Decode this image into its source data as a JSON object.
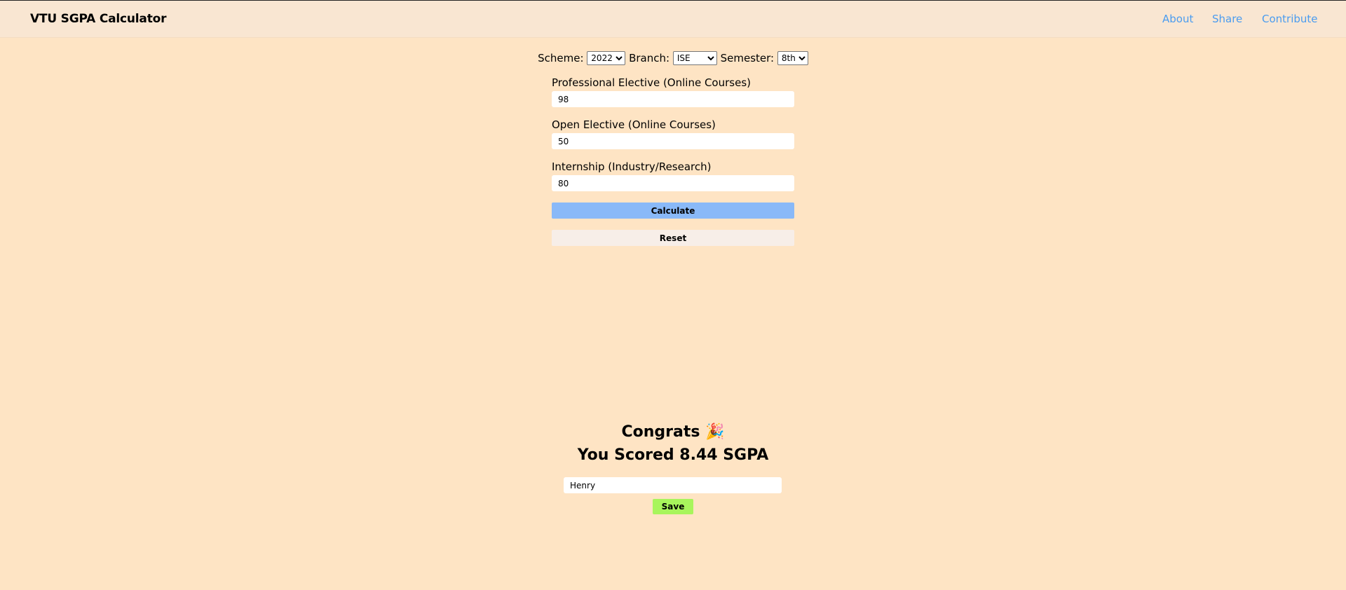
{
  "header": {
    "title": "VTU SGPA Calculator",
    "links": [
      "About",
      "Share",
      "Contribute"
    ]
  },
  "selectors": {
    "scheme_label": "Scheme:",
    "scheme_value": "2022",
    "branch_label": "Branch:",
    "branch_value": "ISE",
    "semester_label": "Semester:",
    "semester_value": "8th"
  },
  "subjects": [
    {
      "label": "Professional Elective (Online Courses)",
      "value": "98"
    },
    {
      "label": "Open Elective (Online Courses)",
      "value": "50"
    },
    {
      "label": "Internship (Industry/Research)",
      "value": "80"
    }
  ],
  "buttons": {
    "calculate": "Calculate",
    "reset": "Reset",
    "save": "Save"
  },
  "result": {
    "congrats": "Congrats 🎉",
    "score": "You Scored 8.44 SGPA",
    "name_value": "Henry"
  },
  "colors": {
    "background": "#fee4c4",
    "link": "#4a9cf0",
    "calculate_button": "#89b9f8",
    "save_button": "#a8f55c"
  }
}
